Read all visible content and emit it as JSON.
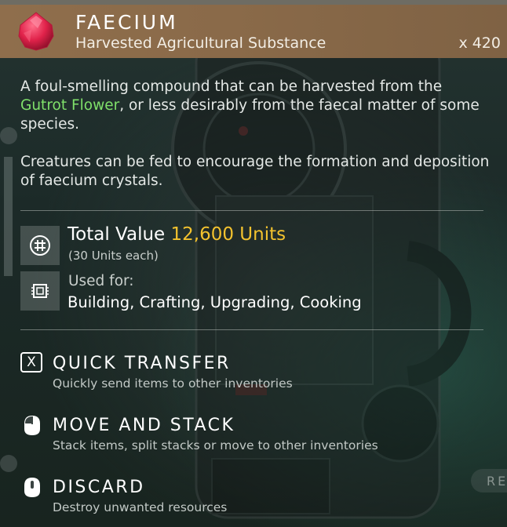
{
  "item": {
    "name": "FAECIUM",
    "subtitle": "Harvested Agricultural Substance",
    "quantity": "x 420"
  },
  "description": {
    "p1_before": "A foul-smelling compound that can be harvested from the ",
    "p1_link": "Gutrot Flower",
    "p1_after": ", or less desirably from the faecal matter of some species.",
    "p2": "Creatures can be fed to encourage the formation and deposition of faecium crystals."
  },
  "value": {
    "label": "Total Value",
    "amount": "12,600 Units",
    "each": "(30 Units each)"
  },
  "usage": {
    "label": "Used for:",
    "list": "Building, Crafting, Upgrading, Cooking"
  },
  "actions": [
    {
      "key": "X",
      "title": "QUICK TRANSFER",
      "desc": "Quickly send items to other inventories",
      "icon": "x-key-icon"
    },
    {
      "title": "MOVE AND STACK",
      "desc": "Stack items, split stacks or move to other inventories",
      "icon": "mouse-left-icon"
    },
    {
      "title": "DISCARD",
      "desc": "Destroy unwanted resources",
      "icon": "mouse-middle-icon"
    }
  ],
  "return_button": "RE",
  "colors": {
    "header": "#8a6a49",
    "highlight_green": "#7fe06a",
    "value_gold": "#f3c22e"
  }
}
